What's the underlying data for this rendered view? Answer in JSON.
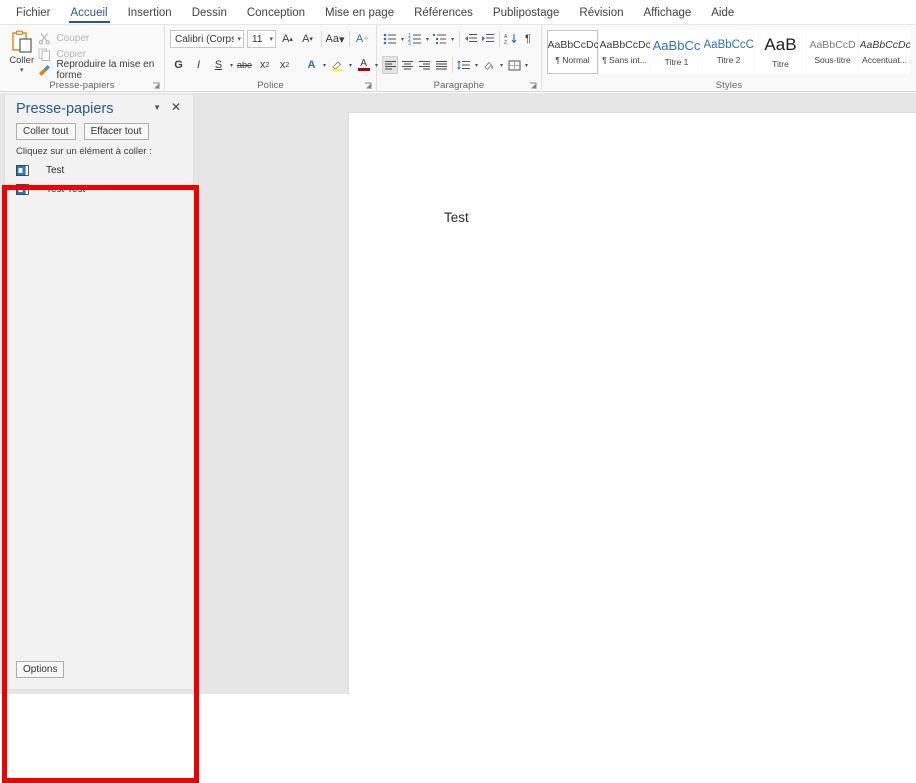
{
  "ribbon": {
    "tabs": [
      {
        "label": "Fichier",
        "active": false
      },
      {
        "label": "Accueil",
        "active": true
      },
      {
        "label": "Insertion",
        "active": false
      },
      {
        "label": "Dessin",
        "active": false
      },
      {
        "label": "Conception",
        "active": false
      },
      {
        "label": "Mise en page",
        "active": false
      },
      {
        "label": "Références",
        "active": false
      },
      {
        "label": "Publipostage",
        "active": false
      },
      {
        "label": "Révision",
        "active": false
      },
      {
        "label": "Affichage",
        "active": false
      },
      {
        "label": "Aide",
        "active": false
      }
    ],
    "clipboard": {
      "group_label": "Presse-papiers",
      "paste_label": "Coller",
      "paste_icon": "clipboard-icon",
      "cut_label": "Couper",
      "cut_icon": "scissors-icon",
      "copy_label": "Copier",
      "copy_icon": "copy-icon",
      "format_painter_label": "Reproduire la mise en forme",
      "format_painter_icon": "paintbrush-icon"
    },
    "font": {
      "group_label": "Police",
      "font_name": "Calibri (Corps)",
      "font_size": "11",
      "grow_label": "A",
      "shrink_label": "A",
      "case_label": "Aa",
      "clear_format_label": "A",
      "bold_label": "G",
      "italic_label": "I",
      "underline_label": "S",
      "strike_label": "abe",
      "subscript_label": "x",
      "superscript_label": "x",
      "text_effects_label": "A",
      "highlight_label": "A",
      "font_color_label": "A",
      "text_effects_color": "#2e75b6",
      "highlight_color": "#ffff00",
      "font_color": "#c00000"
    },
    "paragraph": {
      "group_label": "Paragraphe",
      "bullets_icon": "bullet-list-icon",
      "numbering_icon": "numbered-list-icon",
      "multilevel_icon": "multilevel-list-icon",
      "decrease_indent_icon": "decrease-indent-icon",
      "increase_indent_icon": "increase-indent-icon",
      "sort_icon": "sort-icon",
      "marks_label": "¶",
      "align_left_icon": "align-left-icon",
      "align_center_icon": "align-center-icon",
      "align_right_icon": "align-right-icon",
      "justify_icon": "justify-icon",
      "line_spacing_icon": "line-spacing-icon",
      "shading_icon": "shading-icon",
      "borders_icon": "borders-icon"
    },
    "styles": {
      "group_label": "Styles",
      "items": [
        {
          "preview": "AaBbCcDc",
          "name": "¶ Normal",
          "selected": true,
          "color": "#3c3c3c",
          "size": "10.5px",
          "italic": false
        },
        {
          "preview": "AaBbCcDc",
          "name": "¶ Sans int...",
          "selected": false,
          "color": "#3c3c3c",
          "size": "10.5px",
          "italic": false
        },
        {
          "preview": "AaBbCc",
          "name": "Titre 1",
          "selected": false,
          "color": "#2e75b6",
          "size": "13px",
          "italic": false
        },
        {
          "preview": "AaBbCcC",
          "name": "Titre 2",
          "selected": false,
          "color": "#2e75b6",
          "size": "11.5px",
          "italic": false
        },
        {
          "preview": "AaB",
          "name": "Titre",
          "selected": false,
          "color": "#1f1f1f",
          "size": "17px",
          "italic": false
        },
        {
          "preview": "AaBbCcD",
          "name": "Sous-titre",
          "selected": false,
          "color": "#7f7f7f",
          "size": "10.5px",
          "italic": false
        },
        {
          "preview": "AaBbCcDc",
          "name": "Accentuat...",
          "selected": false,
          "color": "#3c3c3c",
          "size": "10.5px",
          "italic": true
        }
      ]
    }
  },
  "clipboard_pane": {
    "title": "Presse-papiers",
    "caret_icon": "chevron-down-icon",
    "close_icon": "close-icon",
    "paste_all_label": "Coller tout",
    "clear_all_label": "Effacer tout",
    "hint": "Cliquez sur un élément à coller :",
    "items": [
      {
        "text": "Test",
        "icon": "clipboard-item-icon"
      },
      {
        "text": "Test Test",
        "icon": "clipboard-item-icon"
      }
    ],
    "options_label": "Options"
  },
  "document": {
    "body_text": "Test"
  },
  "annotation": {
    "highlight_color": "#ee0000"
  }
}
